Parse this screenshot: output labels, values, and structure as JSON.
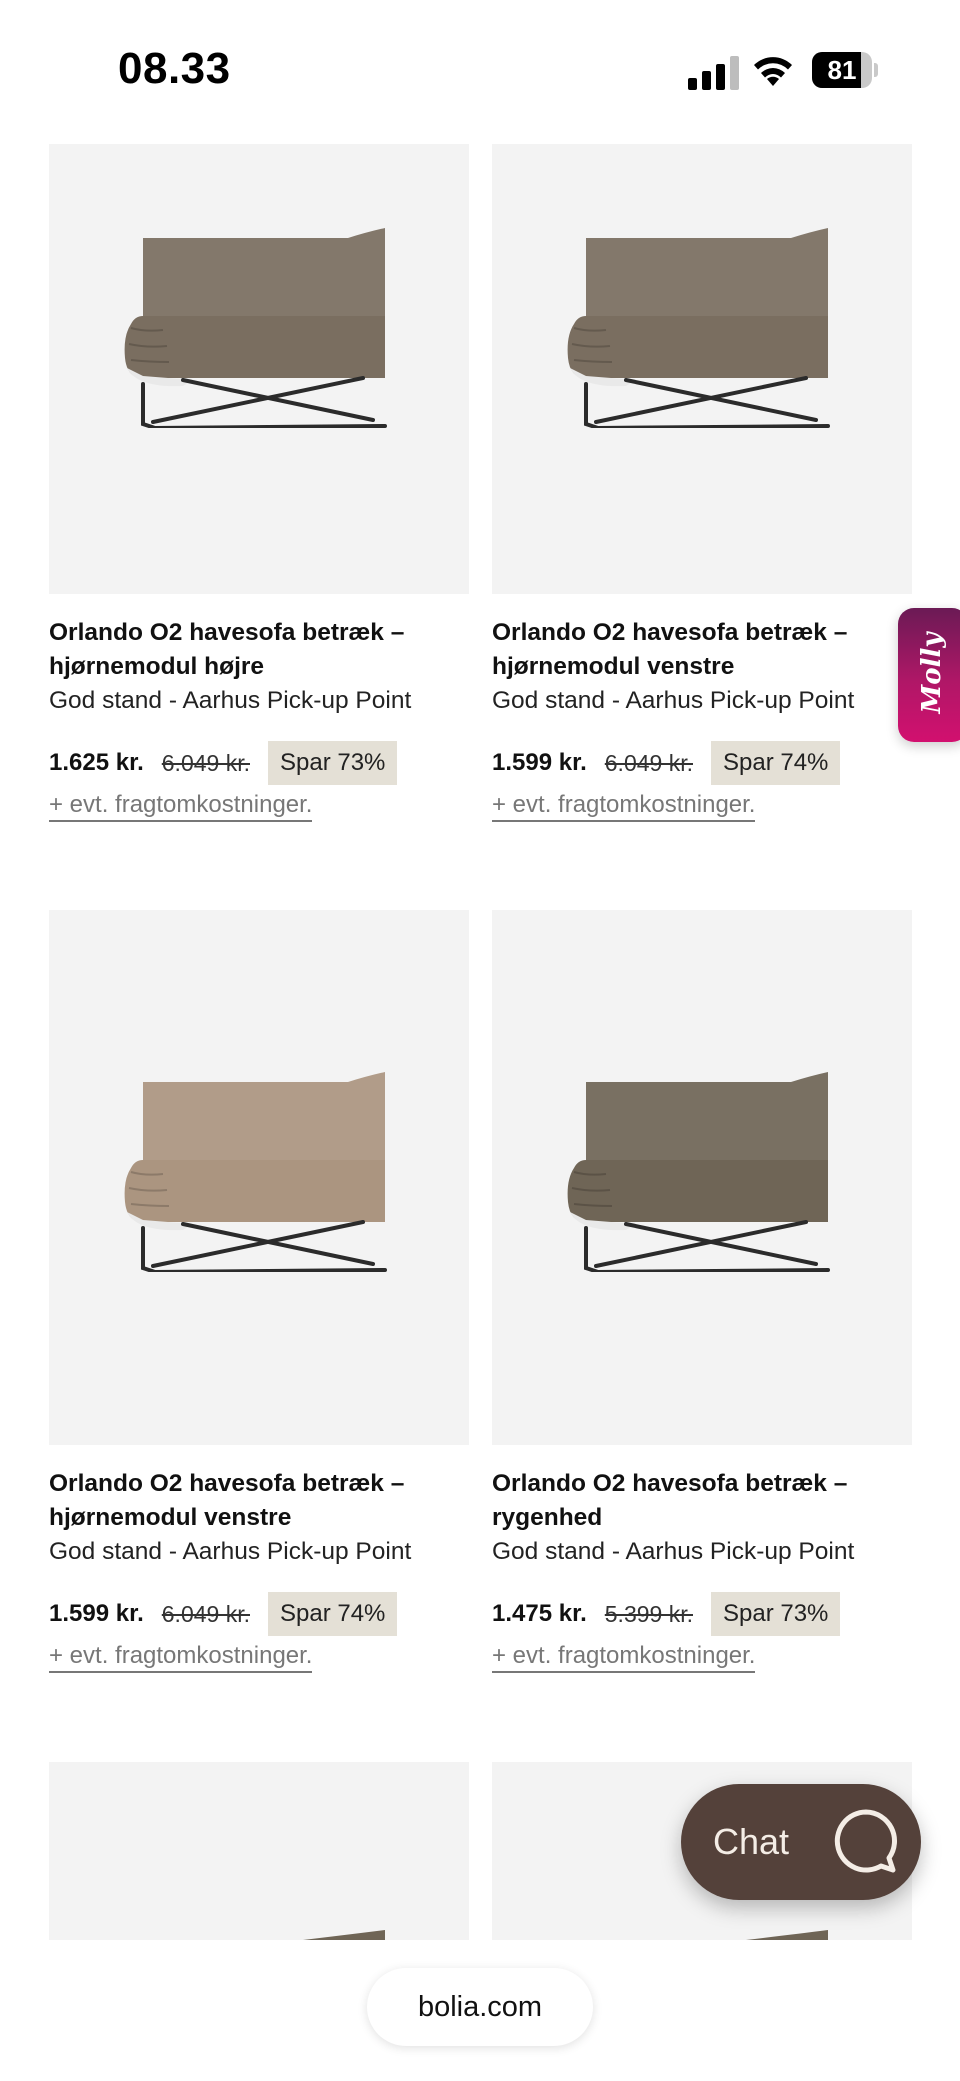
{
  "status_bar": {
    "time": "08.33",
    "battery_level": "81",
    "battery_fraction": 0.81,
    "icons": [
      "signal-icon",
      "wifi-icon",
      "battery-icon"
    ]
  },
  "products": [
    {
      "name": "Orlando O2 havesofa betræk – hjørnemodul højre",
      "subtitle": "God stand - Aarhus Pick-up Point",
      "price": "1.625 kr.",
      "old_price": "6.049 kr.",
      "discount": "Spar 73%",
      "freight_note": "+ evt. fragtomkostninger.",
      "fabric_color": "#7a6e60"
    },
    {
      "name": "Orlando O2 havesofa betræk – hjørnemodul venstre",
      "subtitle": "God stand - Aarhus Pick-up Point",
      "price": "1.599 kr.",
      "old_price": "6.049 kr.",
      "discount": "Spar 74%",
      "freight_note": "+ evt. fragtomkostninger.",
      "fabric_color": "#7a6e60"
    },
    {
      "name": "Orlando O2 havesofa betræk – hjørnemodul venstre",
      "subtitle": "God stand - Aarhus Pick-up Point",
      "price": "1.599 kr.",
      "old_price": "6.049 kr.",
      "discount": "Spar 74%",
      "freight_note": "+ evt. fragtomkostninger.",
      "fabric_color": "#ab9580"
    },
    {
      "name": "Orlando O2 havesofa betræk – rygenhed",
      "subtitle": "God stand - Aarhus Pick-up Point",
      "price": "1.475 kr.",
      "old_price": "5.399 kr.",
      "discount": "Spar 73%",
      "freight_note": "+ evt. fragtomkostninger.",
      "fabric_color": "#6f6556"
    }
  ],
  "molly_tab": {
    "label": "Molly",
    "color": "#b01767"
  },
  "chat": {
    "label": "Chat",
    "color": "#54413a"
  },
  "browser": {
    "url": "bolia.com"
  }
}
